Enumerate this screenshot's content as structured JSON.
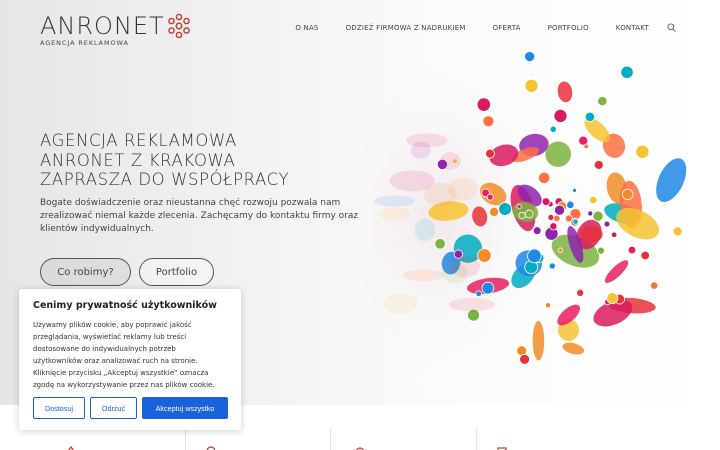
{
  "brand": {
    "name": "ANRONET",
    "tagline": "AGENCJA REKLAMOWA",
    "accent": "#c0392b"
  },
  "nav": {
    "items": [
      "O NAS",
      "ODZIEŻ FIRMOWA Z NADRUKIEM",
      "OFERTA",
      "PORTFOLIO",
      "KONTAKT"
    ],
    "search_icon": "search-icon"
  },
  "hero": {
    "headline": [
      "AGENCJA REKLAMOWA",
      "ANRONET Z KRAKOWA",
      "ZAPRASZA DO WSPÓŁPRACY"
    ],
    "description": "Bogate doświadczenie oraz nieustanna chęć rozwoju pozwala nam zrealizować niemal każde zlecenia. Zachęcamy do kontaktu firmy oraz klientów indywidualnych.",
    "button_primary": "Co robimy?",
    "button_secondary": "Portfolio"
  },
  "cookie": {
    "title": "Cenimy prywatność użytkowników",
    "text": "Używamy plików cookie, aby poprawić jakość przeglądania, wyświetlać reklamy lub treści dostosowane do indywidualnych potrzeb użytkowników oraz analizować ruch na stronie. Kliknięcie przycisku „Akceptuj wszystkie” oznacza zgodę na wykorzystywanie przez nas plików cookie.",
    "customize": "Dostosuj",
    "reject": "Odrzuć",
    "accept": "Akceptuj wszystko",
    "button_color": "#1863dc"
  }
}
